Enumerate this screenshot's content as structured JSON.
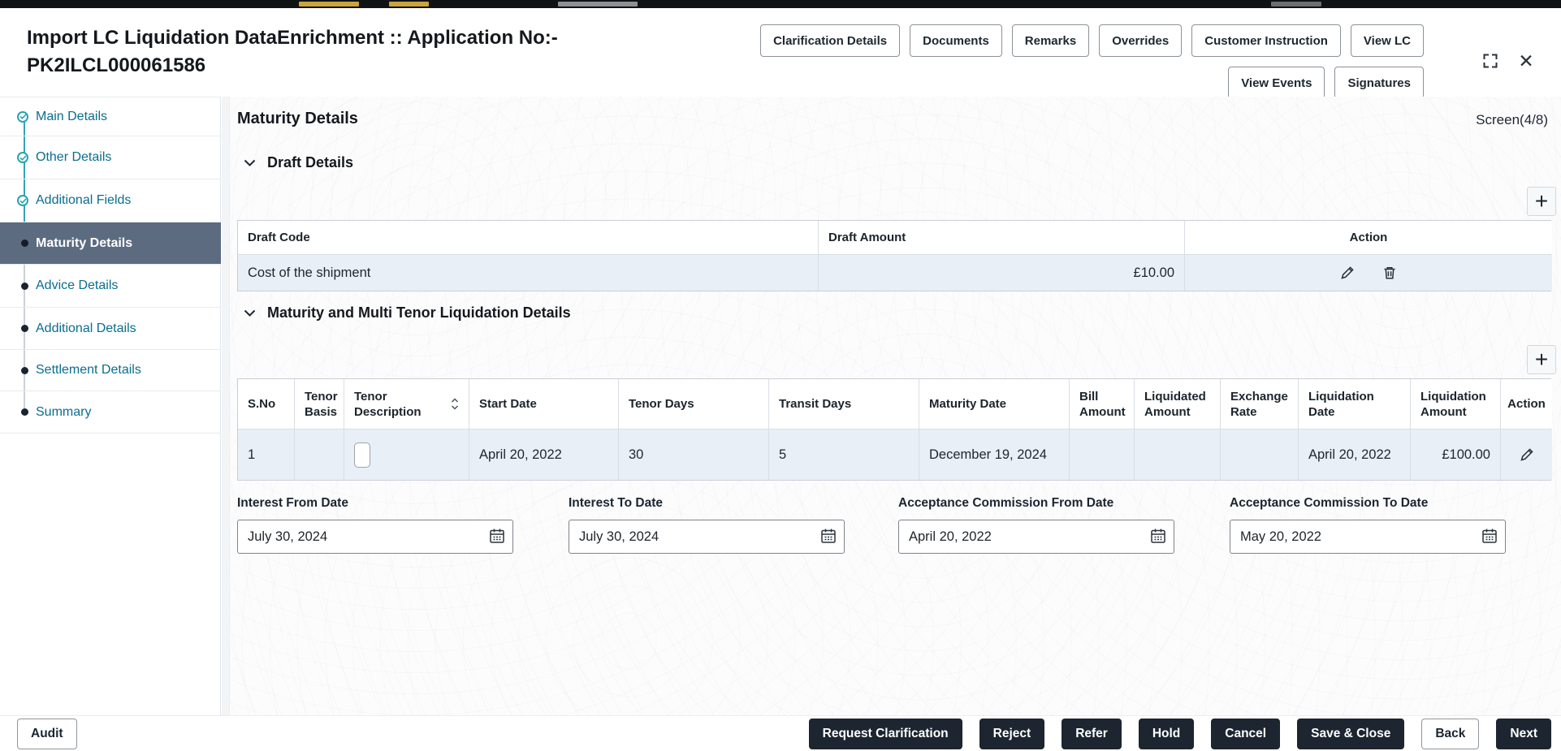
{
  "window": {
    "title_line1": "Import LC Liquidation DataEnrichment :: Application No:-",
    "title_line2": "PK2ILCL000061586",
    "toolbar_row1": [
      "Clarification Details",
      "Documents",
      "Remarks",
      "Overrides",
      "Customer Instruction",
      "View LC"
    ],
    "toolbar_row2": [
      "View Events",
      "Signatures"
    ]
  },
  "sidebar": {
    "items": [
      {
        "label": "Main Details",
        "state": "completed"
      },
      {
        "label": "Other Details",
        "state": "completed"
      },
      {
        "label": "Additional Fields",
        "state": "completed"
      },
      {
        "label": "Maturity Details",
        "state": "active"
      },
      {
        "label": "Advice Details",
        "state": "pending"
      },
      {
        "label": "Additional Details",
        "state": "pending"
      },
      {
        "label": "Settlement Details",
        "state": "pending"
      },
      {
        "label": "Summary",
        "state": "pending"
      }
    ]
  },
  "main": {
    "title": "Maturity Details",
    "screen_indicator": "Screen(4/8)",
    "draft_section": {
      "title": "Draft Details",
      "headers": [
        "Draft Code",
        "Draft Amount",
        "Action"
      ],
      "row": {
        "draft_code": "Cost of the shipment",
        "draft_amount": "£10.00"
      }
    },
    "tenor_section": {
      "title": "Maturity and Multi Tenor Liquidation Details",
      "headers": [
        "S.No",
        "Tenor Basis",
        "Tenor Description",
        "Start Date",
        "Tenor Days",
        "Transit Days",
        "Maturity Date",
        "Bill Amount",
        "Liquidated Amount",
        "Exchange Rate",
        "Liquidation Date",
        "Liquidation Amount",
        "Action"
      ],
      "row": {
        "s_no": "1",
        "tenor_basis": "",
        "tenor_description": "",
        "start_date": "April 20, 2022",
        "tenor_days": "30",
        "transit_days": "5",
        "maturity_date": "December 19, 2024",
        "bill_amount": "",
        "liquidated_amount": "",
        "exchange_rate": "",
        "liquidation_date": "April 20, 2022",
        "liquidation_amount": "£100.00"
      }
    },
    "date_fields": [
      {
        "label": "Interest From Date",
        "value": "July 30, 2024"
      },
      {
        "label": "Interest To Date",
        "value": "July 30, 2024"
      },
      {
        "label": "Acceptance Commission From Date",
        "value": "April 20, 2022"
      },
      {
        "label": "Acceptance Commission To Date",
        "value": "May 20, 2022"
      }
    ]
  },
  "footer": {
    "audit_label": "Audit",
    "actions": [
      {
        "label": "Request Clarification",
        "variant": "dark"
      },
      {
        "label": "Reject",
        "variant": "dark"
      },
      {
        "label": "Refer",
        "variant": "dark"
      },
      {
        "label": "Hold",
        "variant": "dark"
      },
      {
        "label": "Cancel",
        "variant": "dark"
      },
      {
        "label": "Save & Close",
        "variant": "dark"
      },
      {
        "label": "Back",
        "variant": "light"
      },
      {
        "label": "Next",
        "variant": "dark"
      }
    ]
  },
  "icons": {
    "add": "+",
    "close": "✕",
    "check": "✓"
  },
  "colors": {
    "link": "#0b6d8e",
    "active_step_bg": "#5c6b80",
    "row_highlight": "#e9eff7",
    "dark_button": "#1c2530",
    "step_check": "#2aa3ae"
  }
}
